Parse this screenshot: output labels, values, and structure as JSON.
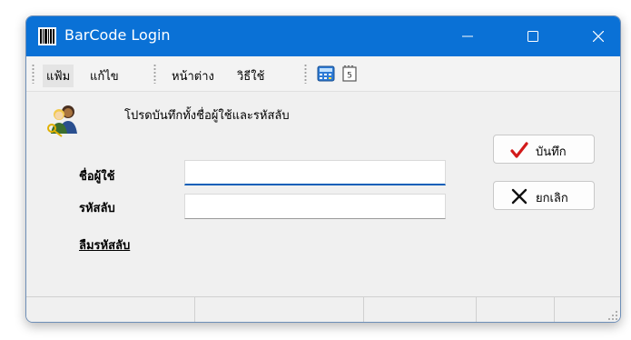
{
  "window": {
    "title": "BarCode Login",
    "title_bar_color": "#0a71d6",
    "app_icon": "barcode-icon",
    "controls": [
      "minimize-icon",
      "maximize-icon",
      "close-icon"
    ]
  },
  "menubar": {
    "items": [
      {
        "label": "แฟ้ม",
        "active": true
      },
      {
        "label": "แก้ไข",
        "active": false
      },
      {
        "label": "หน้าต่าง",
        "active": false
      },
      {
        "label": "วิธีใช้",
        "active": false
      }
    ],
    "tools": [
      "calculator-icon",
      "calendar-icon"
    ]
  },
  "form": {
    "icon": "users-keys-icon",
    "prompt": "โปรดบันทึกทั้งชื่อผู้ใช้และรหัสลับ",
    "username_label": "ชื่อผู้ใช้",
    "username_value": "",
    "password_label": "รหัสลับ",
    "password_value": "",
    "forgot_link": "ลืมรหัสลับ"
  },
  "buttons": {
    "save_label": "บันทึก",
    "save_icon": "checkmark-icon",
    "cancel_label": "ยกเลิก",
    "cancel_icon": "x-icon"
  },
  "accent_colors": {
    "check": "#d21a1a",
    "focus_underline": "#0a5fb8"
  }
}
